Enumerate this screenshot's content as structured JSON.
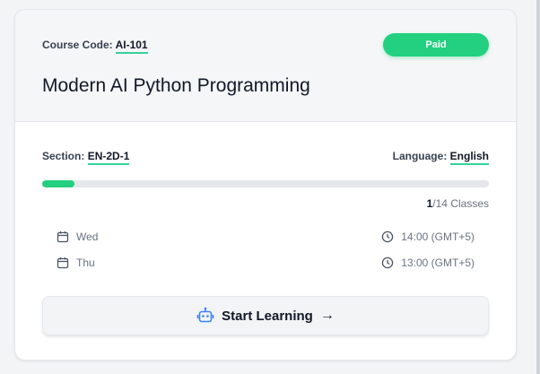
{
  "course": {
    "code_label": "Course Code:",
    "code_value": "AI-101",
    "status": "Paid",
    "title": "Modern AI Python Programming"
  },
  "meta": {
    "section_label": "Section:",
    "section_value": "EN-2D-1",
    "language_label": "Language:",
    "language_value": "English"
  },
  "progress": {
    "completed": "1",
    "total_text": "/14 Classes",
    "fraction": 0.0714
  },
  "schedule": [
    {
      "day": "Wed",
      "time": "14:00 (GMT+5)"
    },
    {
      "day": "Thu",
      "time": "13:00 (GMT+5)"
    }
  ],
  "action": {
    "label": "Start Learning",
    "arrow": "→"
  },
  "icons": {
    "calendar": "calendar-icon",
    "clock": "clock-icon",
    "robot": "robot-icon"
  },
  "colors": {
    "accent": "#22d07f",
    "robot": "#3b82f6"
  }
}
